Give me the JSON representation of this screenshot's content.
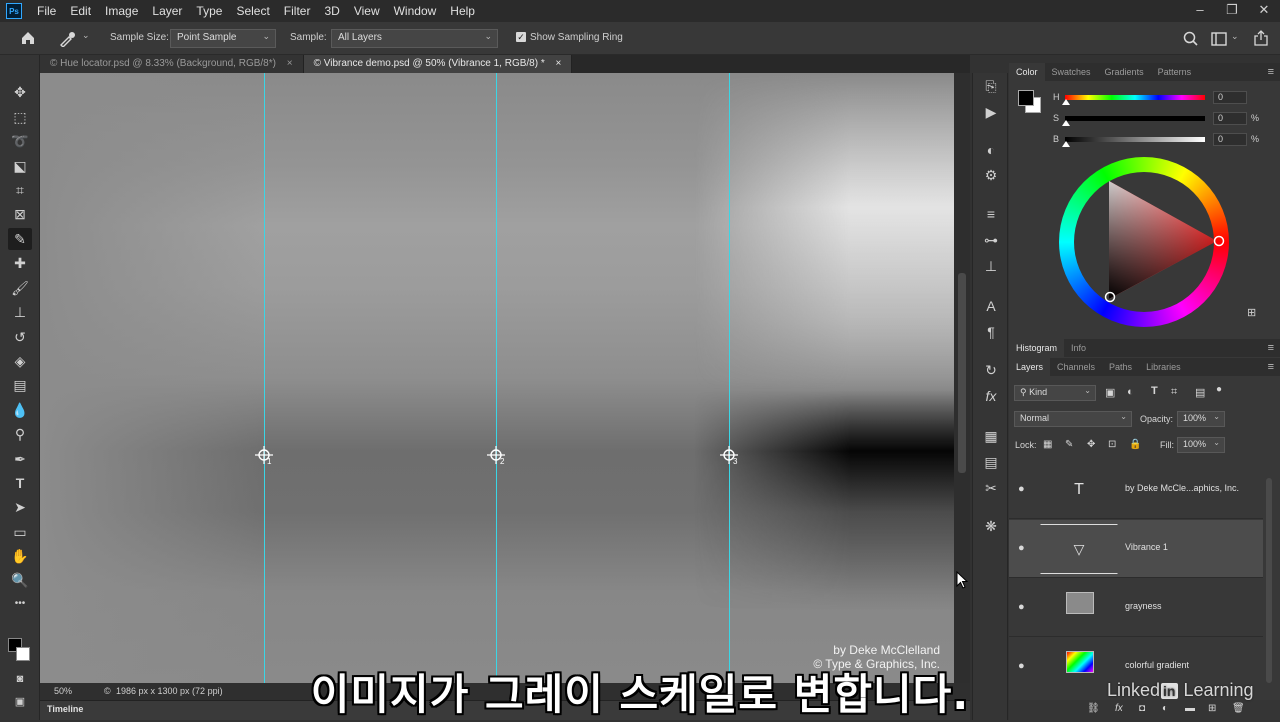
{
  "menubar": {
    "logo": "Ps",
    "items": [
      "File",
      "Edit",
      "Image",
      "Layer",
      "Type",
      "Select",
      "Filter",
      "3D",
      "View",
      "Window",
      "Help"
    ],
    "window_controls": [
      "–",
      "❐",
      "✕"
    ]
  },
  "options": {
    "sample_size_label": "Sample Size:",
    "sample_size_value": "Point Sample",
    "sample_label": "Sample:",
    "sample_value": "All Layers",
    "show_ring_label": "Show Sampling Ring",
    "show_ring_checked": true
  },
  "tabs": [
    {
      "label": "© Hue locator.psd @ 8.33% (Background, RGB/8*)",
      "close": "×",
      "active": false
    },
    {
      "label": "© Vibrance demo.psd @ 50% (Vibrance 1, RGB/8) *",
      "close": "×",
      "active": true
    }
  ],
  "canvas": {
    "samplers": [
      "1",
      "2",
      "3"
    ],
    "credit_line1": "by Deke McClelland",
    "credit_line2": "© Type & Graphics, Inc."
  },
  "status": {
    "zoom": "50%",
    "doc_info": "1986 px x 1300 px (72 ppi)",
    "timeline": "Timeline"
  },
  "color_panel": {
    "tabs": [
      "Color",
      "Swatches",
      "Gradients",
      "Patterns"
    ],
    "active_tab": "Color",
    "h_label": "H",
    "h_value": "0",
    "s_label": "S",
    "s_value": "0",
    "s_unit": "%",
    "b_label": "B",
    "b_value": "0",
    "b_unit": "%",
    "hue_marker_color": "#ff2020"
  },
  "histogram_tabs": [
    "Histogram",
    "Info"
  ],
  "layers_panel": {
    "tabs": [
      "Layers",
      "Channels",
      "Paths",
      "Libraries"
    ],
    "kind_filter": "Kind",
    "blend_mode": "Normal",
    "opacity_label": "Opacity:",
    "opacity_value": "100%",
    "lock_label": "Lock:",
    "fill_label": "Fill:",
    "fill_value": "100%",
    "layers": [
      {
        "name": "by Deke McCle...aphics, Inc.",
        "type": "text",
        "selected": false
      },
      {
        "name": "Vibrance 1",
        "type": "adjustment",
        "selected": true
      },
      {
        "name": "grayness",
        "type": "pixel",
        "selected": false
      },
      {
        "name": "colorful gradient",
        "type": "pixel",
        "selected": false
      }
    ]
  },
  "subtitle": "이미지가 그레이 스케일로 변합니다.",
  "watermark": {
    "before": "Linked",
    "in": "in",
    "after": " Learning"
  }
}
